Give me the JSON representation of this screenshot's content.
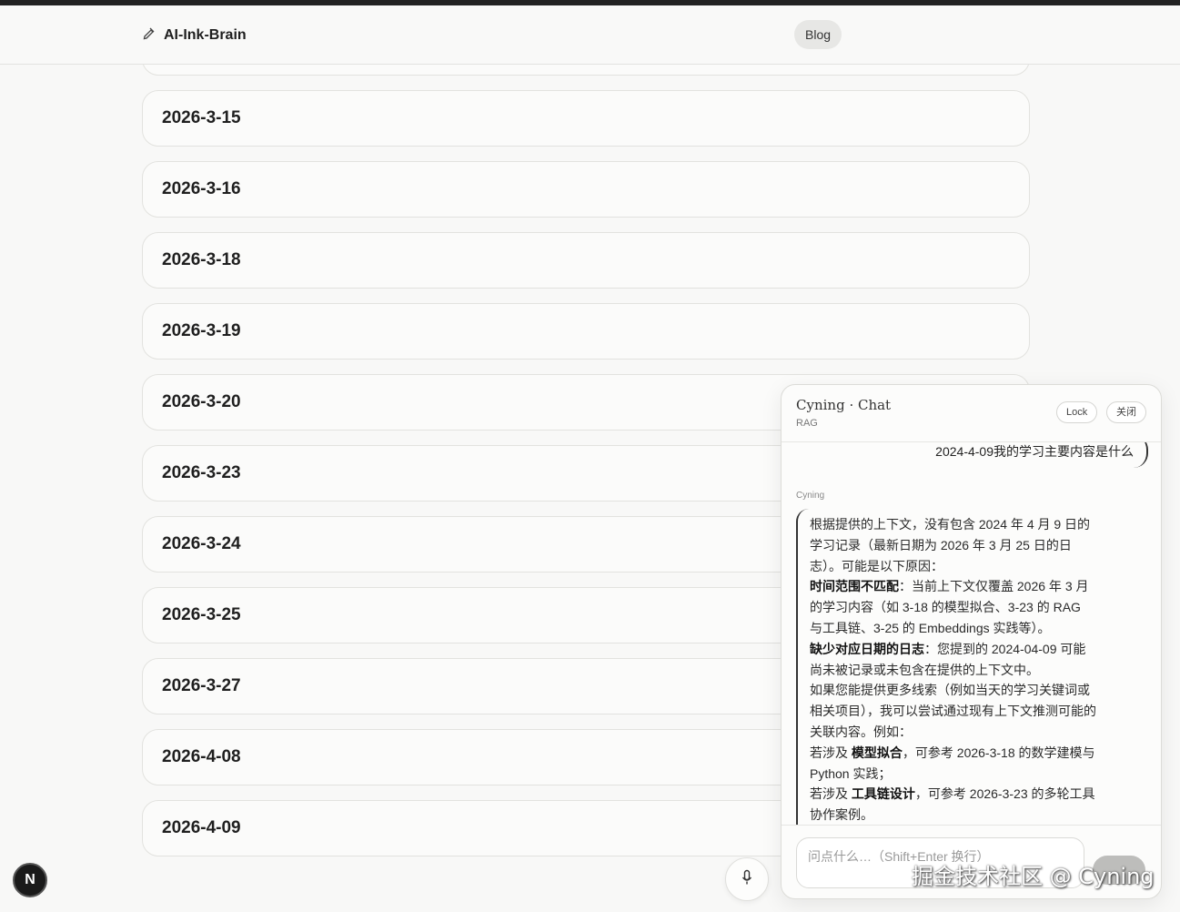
{
  "header": {
    "brand": "AI-Ink-Brain",
    "nav_blog": "Blog"
  },
  "entries": [
    "2026-3-15",
    "2026-3-16",
    "2026-3-18",
    "2026-3-19",
    "2026-3-20",
    "2026-3-23",
    "2026-3-24",
    "2026-3-25",
    "2026-3-27",
    "2026-4-08",
    "2026-4-09"
  ],
  "badge": "N",
  "chat": {
    "title": "Cyning · Chat",
    "subtitle": "RAG",
    "lock_label": "Lock",
    "close_label": "关闭",
    "user_message": "2024-4-09我的学习主要内容是什么",
    "bot_name": "Cyning",
    "bot_reply": {
      "intro": "根据提供的上下文，没有包含 2024 年 4 月 9 日的学习记录（最新日期为 2026 年 3 月 25 日的日志）。可能是以下原因：",
      "reason1_title": "时间范围不匹配",
      "reason1_text": "：当前上下文仅覆盖 2026 年 3 月的学习内容（如 3-18 的模型拟合、3-23 的 RAG 与工具链、3-25 的 Embeddings 实践等）。",
      "reason2_title": "缺少对应日期的日志",
      "reason2_text": "：您提到的 2024-04-09 可能尚未被记录或未包含在提供的上下文中。",
      "suggest": "如果您能提供更多线索（例如当天的学习关键词或相关项目），我可以尝试通过现有上下文推测可能的关联内容。例如：",
      "ex1_pre": "若涉及 ",
      "ex1_bold": "模型拟合",
      "ex1_post": "，可参考 2026-3-18 的数学建模与 Python 实践；",
      "ex2_pre": "若涉及 ",
      "ex2_bold": "工具链设计",
      "ex2_post": "，可参考 2026-3-23 的多轮工具协作案例。"
    },
    "input_placeholder": "问点什么…（Shift+Enter 换行）"
  },
  "watermark": "掘金技术社区 @ Cyning"
}
